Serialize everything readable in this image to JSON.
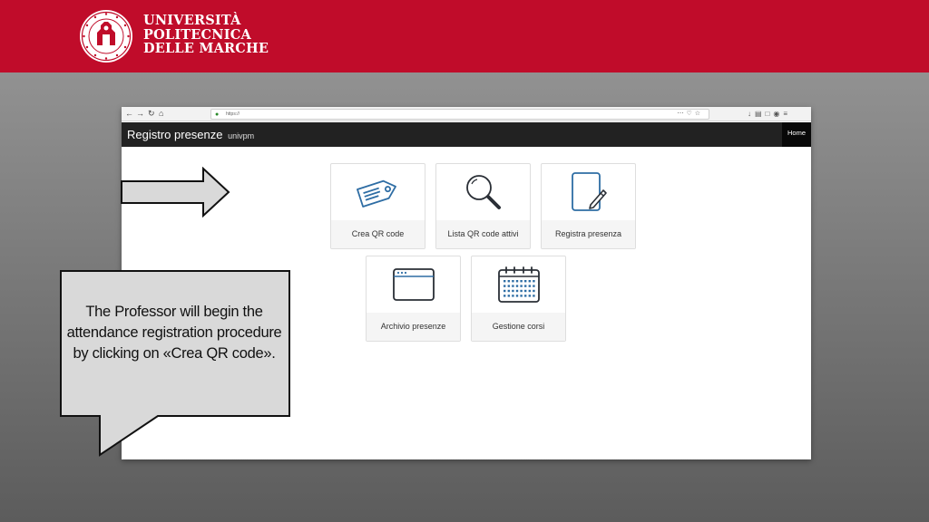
{
  "university": {
    "name_lines": [
      "UNIVERSITÀ",
      "POLITECNICA",
      "DELLE MARCHE"
    ]
  },
  "browser": {
    "url": "https://",
    "nav_icons": [
      "back-icon",
      "forward-icon",
      "reload-icon",
      "home-icon"
    ]
  },
  "app": {
    "title": "Registro presenze",
    "subtitle": "univpm",
    "home_label": "Home"
  },
  "tiles": [
    {
      "label": "Crea QR code",
      "icon": "tag-icon"
    },
    {
      "label": "Lista QR code attivi",
      "icon": "search-icon"
    },
    {
      "label": "Registra presenza",
      "icon": "edit-document-icon"
    },
    {
      "label": "Archivio presenze",
      "icon": "browser-window-icon"
    },
    {
      "label": "Gestione corsi",
      "icon": "calendar-icon"
    }
  ],
  "callout": {
    "text": "The Professor will begin the attendance registration procedure by clicking on «Crea QR code»."
  },
  "colors": {
    "brand_red": "#c00c2a",
    "appbar": "#222222",
    "icon_blue": "#2e6da4"
  }
}
